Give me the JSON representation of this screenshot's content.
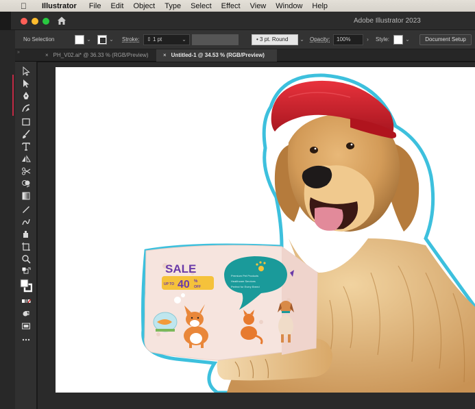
{
  "menubar": {
    "app": "Illustrator",
    "items": [
      "File",
      "Edit",
      "Object",
      "Type",
      "Select",
      "Effect",
      "View",
      "Window",
      "Help"
    ]
  },
  "window": {
    "title": "Adobe Illustrator 2023"
  },
  "controlbar": {
    "selection": "No Selection",
    "stroke_label": "Stroke:",
    "stroke_value": "1 pt",
    "brush": "3 pt. Round",
    "opacity_label": "Opacity:",
    "opacity_value": "100%",
    "style_label": "Style:",
    "document_setup": "Document Setup"
  },
  "tabs": [
    {
      "close": "×",
      "label": "PH_V02.ai* @ 36.33 % (RGB/Preview)"
    },
    {
      "close": "×",
      "label": "Untitled-1 @ 34.53 % (RGB/Preview)"
    }
  ],
  "tools": [
    "selection-tool",
    "direct-selection-tool",
    "pen-tool",
    "curvature-tool",
    "rectangle-tool",
    "paintbrush-tool",
    "type-tool",
    "reflect-tool",
    "scissors-tool",
    "shape-builder-tool",
    "gradient-tool",
    "eyedropper-tool",
    "blend-tool",
    "symbol-sprayer-tool",
    "artboard-tool",
    "zoom-tool",
    "default-colors-tool",
    "fill-stroke-swatch",
    "color-mode-buttons",
    "draw-mode-tool",
    "screen-mode-tool",
    "edit-toolbar-button"
  ],
  "box_art": {
    "sale": "SALE",
    "up_to": "UP TO",
    "percent": "40",
    "pct_sign": "%",
    "off": "OFF",
    "bullets": [
      "Premium Pet Products",
      "Healthcare Services",
      "Perfect for Every Breed"
    ]
  },
  "colors": {
    "cap_red": "#d81f2a",
    "sticker_outline": "#3dc0dd",
    "box_pink": "#f6e4de",
    "sale_purple": "#6a3aa8",
    "teal_bubble": "#1a9a9a"
  }
}
